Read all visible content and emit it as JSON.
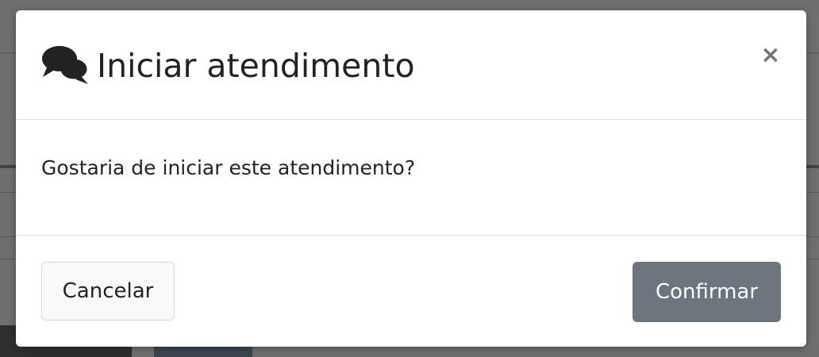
{
  "modal": {
    "title": "Iniciar atendimento",
    "icon": "comments-icon",
    "close_label": "×",
    "message": "Gostaria de iniciar este atendimento?",
    "cancel_label": "Cancelar",
    "confirm_label": "Confirmar"
  },
  "colors": {
    "confirm_button": "#6c757d",
    "cancel_button": "#f8f9fa",
    "overlay": "#6f6f6f"
  }
}
